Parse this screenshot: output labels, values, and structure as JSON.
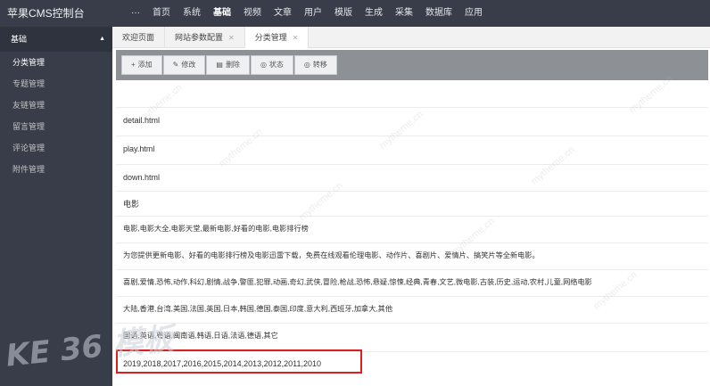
{
  "app": {
    "title": "苹果CMS控制台"
  },
  "topnav": {
    "items": [
      "···",
      "首页",
      "系统",
      "基础",
      "视频",
      "文章",
      "用户",
      "模版",
      "生成",
      "采集",
      "数据库",
      "应用"
    ],
    "active": "基础"
  },
  "sidebar": {
    "header": "基础",
    "items": [
      "分类管理",
      "专题管理",
      "友链管理",
      "留言管理",
      "评论管理",
      "附件管理"
    ],
    "active": "分类管理"
  },
  "tabs": [
    {
      "label": "欢迎页面",
      "closable": false
    },
    {
      "label": "网站参数配置",
      "closable": true
    },
    {
      "label": "分类管理",
      "closable": true,
      "active": true
    }
  ],
  "toolbar": {
    "buttons": [
      {
        "icon": "plus-icon",
        "label": "添加"
      },
      {
        "icon": "edit-icon",
        "label": "修改"
      },
      {
        "icon": "trash-icon",
        "label": "删除"
      },
      {
        "icon": "status-icon",
        "label": "状态"
      },
      {
        "icon": "move-icon",
        "label": "转移"
      }
    ]
  },
  "form_rows": [
    "detail.html",
    "play.html",
    "down.html",
    "电影",
    "电影,电影大全,电影天堂,最新电影,好看的电影,电影排行榜",
    "为您提供更新电影、好看的电影排行榜及电影迅雷下载，免费在线观看伦理电影、动作片、喜剧片、爱情片、搞笑片等全新电影。",
    "喜剧,爱情,恐怖,动作,科幻,剧情,战争,警匪,犯罪,动画,奇幻,武侠,冒险,枪战,恐怖,悬疑,惊悚,经典,青春,文艺,微电影,古装,历史,运动,农村,儿童,网络电影",
    "大陆,香港,台湾,美国,法国,英国,日本,韩国,德国,泰国,印度,意大利,西班牙,加拿大,其他",
    "国语,英语,粤语,闽南语,韩语,日语,法语,德语,其它",
    "2019,2018,2017,2016,2015,2014,2013,2012,2011,2010"
  ],
  "watermark": {
    "text": "mytheme.cn",
    "site": "KE 36 模板"
  },
  "colors": {
    "topbar": "#393d49",
    "toolbar": "#8d9196",
    "highlight": "#d9201e"
  }
}
